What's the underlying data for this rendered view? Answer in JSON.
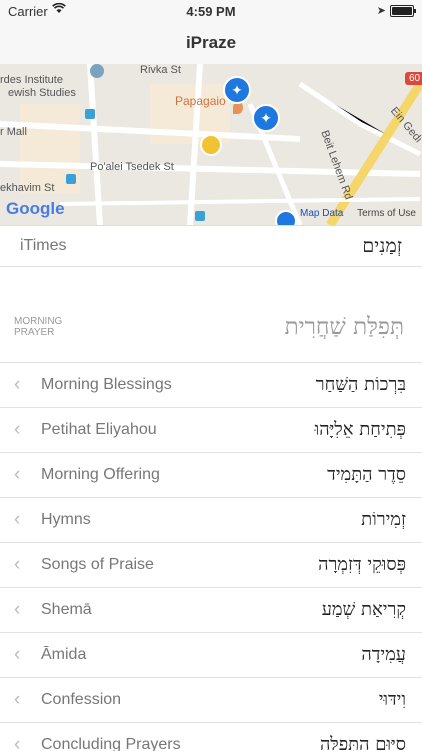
{
  "status_bar": {
    "carrier": "Carrier",
    "time": "4:59 PM"
  },
  "nav": {
    "title": "iPraze"
  },
  "map": {
    "labels": [
      "rdes Institute",
      "ewish Studies",
      "r Mall",
      "Po'alei Tsedek St",
      "ekhavim St",
      "Rivka St",
      "Beit Lehem Rd",
      "Ein Gedi"
    ],
    "poi": "Papagaio",
    "route": "60",
    "logo": "Google",
    "map_data": "Map Data",
    "terms": "Terms of Use"
  },
  "itimes": {
    "en": "iTimes",
    "he": "זְמַנִים"
  },
  "section": {
    "en_line1": "MORNING",
    "en_line2": "PRAYER",
    "he": "תְּפִלַּת שַׁחֲרִית"
  },
  "rows": [
    {
      "en": "Morning Blessings",
      "he": "בִּרְכוֹת הַשַּׁחַר"
    },
    {
      "en": "Petihat Eliyahou",
      "he": "פְּתִיחַת אֵלִיָּהוּ"
    },
    {
      "en": "Morning Offering",
      "he": "סֵדֶר הַתָּמִיד"
    },
    {
      "en": "Hymns",
      "he": "זְמִירוֹת"
    },
    {
      "en": "Songs of Praise",
      "he": "פְּסוּקֵי דְּזִמְרָה"
    },
    {
      "en": "Shemā",
      "he": "קְרִיאַת שְׁמַע"
    },
    {
      "en": "Āmida",
      "he": "עֲמִידָה"
    },
    {
      "en": "Confession",
      "he": "וִידּוּי"
    },
    {
      "en": "Concluding Prayers",
      "he": "סִיּוּם הַתְּפִלָּה"
    }
  ],
  "colors": {
    "accent": "#1e78e0",
    "map_road_major": "#f4d66b",
    "map_bg": "#ebe8e2"
  },
  "icons": {
    "row_chevron": "chevron-left-icon"
  }
}
